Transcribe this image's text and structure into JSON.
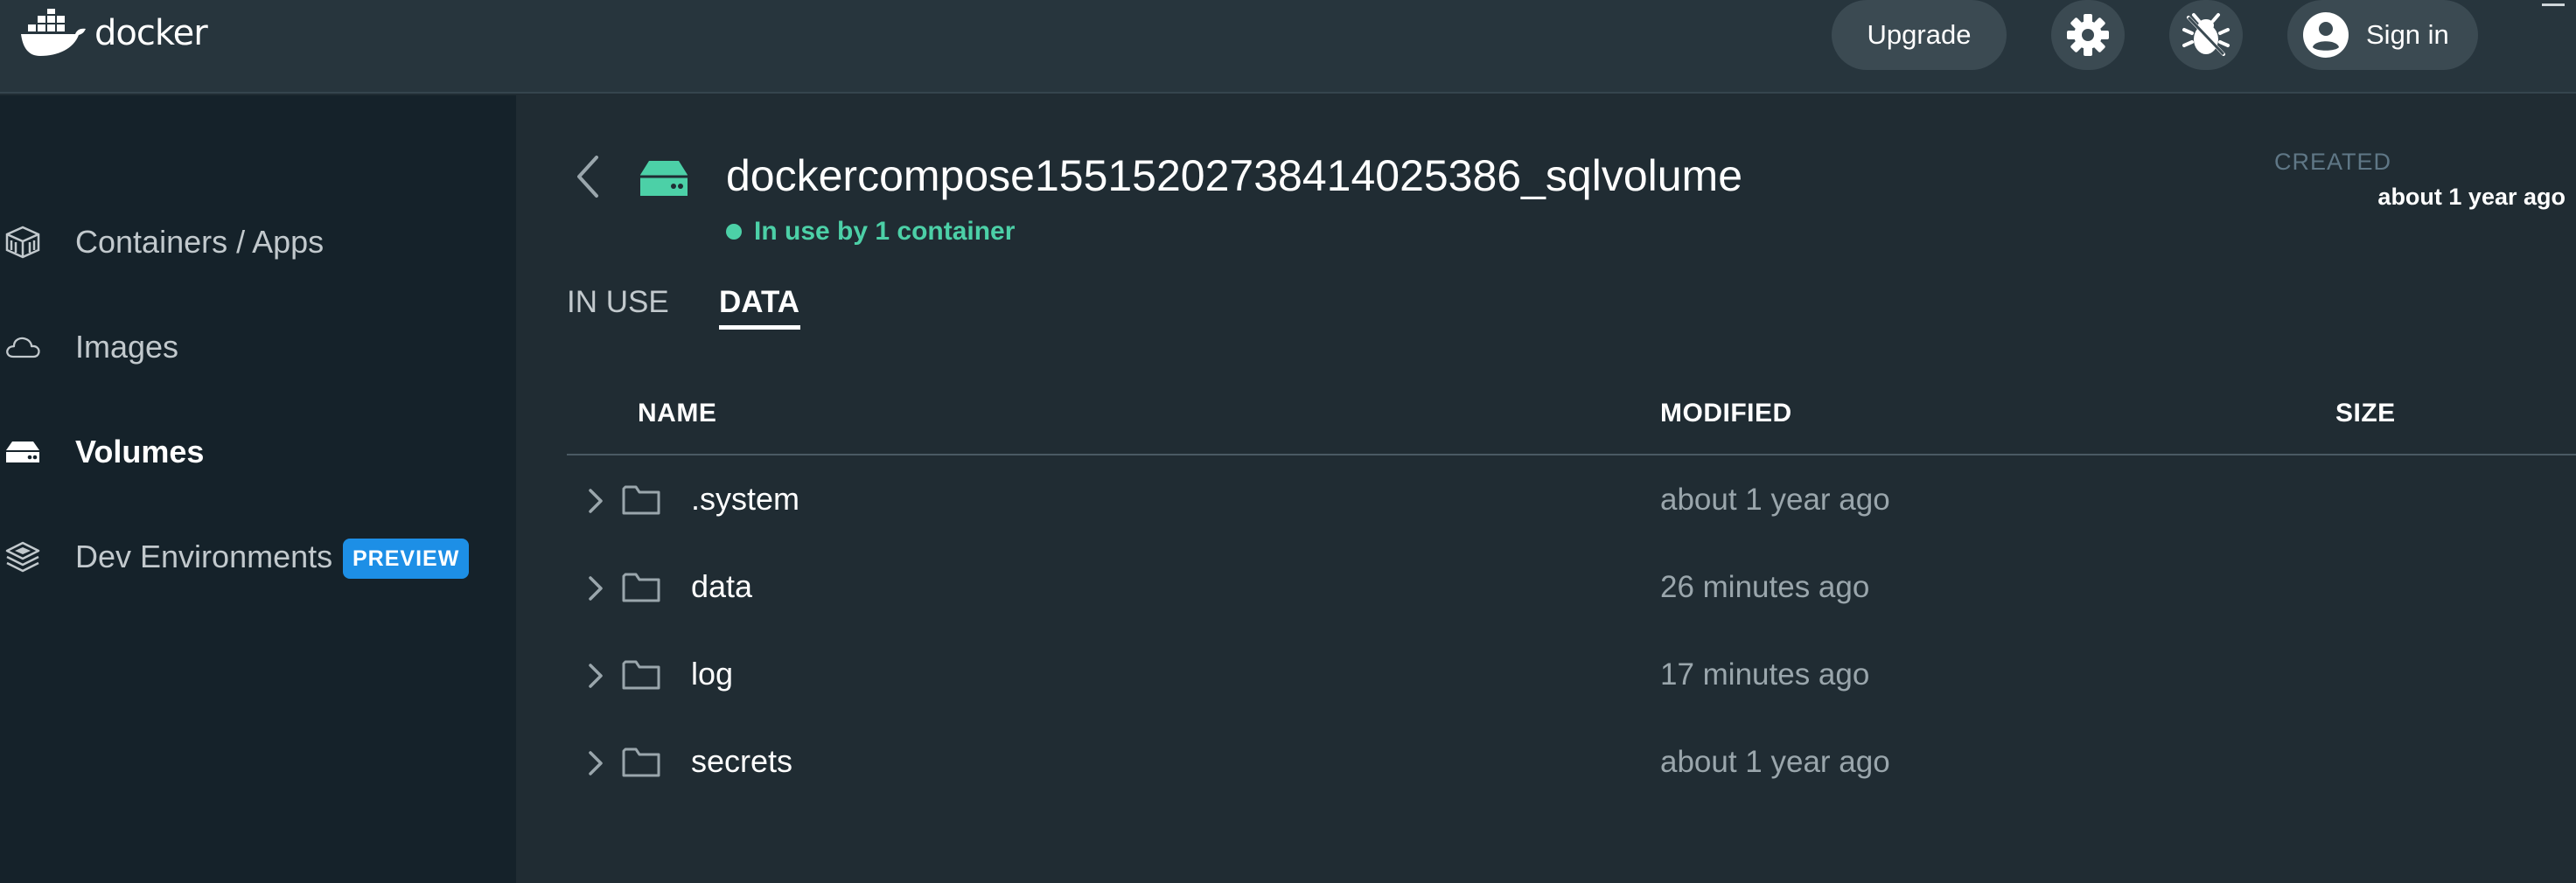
{
  "app": {
    "logo_text": "docker"
  },
  "topbar": {
    "upgrade_label": "Upgrade",
    "signin_label": "Sign in",
    "settings_icon": "gear-icon",
    "troubleshoot_icon": "bug-icon"
  },
  "sidebar": {
    "items": [
      {
        "label": "Containers / Apps",
        "icon": "containers-icon",
        "active": false
      },
      {
        "label": "Images",
        "icon": "cloud-icon",
        "active": false
      },
      {
        "label": "Volumes",
        "icon": "volume-icon",
        "active": true
      },
      {
        "label": "Dev Environments",
        "icon": "dev-env-icon",
        "active": false,
        "badge": "PREVIEW"
      }
    ]
  },
  "volume": {
    "name": "dockercompose15515202738414025386_sqlvolume",
    "status": "In use by 1 container",
    "created_label": "CREATED",
    "created_value": "about 1 year ago"
  },
  "tabs": [
    {
      "label": "IN USE",
      "active": false
    },
    {
      "label": "DATA",
      "active": true
    }
  ],
  "table": {
    "columns": [
      "NAME",
      "MODIFIED",
      "SIZE"
    ],
    "rows": [
      {
        "name": ".system",
        "modified": "about 1 year ago"
      },
      {
        "name": "data",
        "modified": "26 minutes ago"
      },
      {
        "name": "log",
        "modified": "17 minutes ago"
      },
      {
        "name": "secrets",
        "modified": "about 1 year ago"
      }
    ]
  },
  "colors": {
    "background": "#202c33",
    "topbar": "#27353d",
    "sidebar": "#15222a",
    "accent_green": "#4cd0a7",
    "badge_blue": "#1d8fe6"
  }
}
